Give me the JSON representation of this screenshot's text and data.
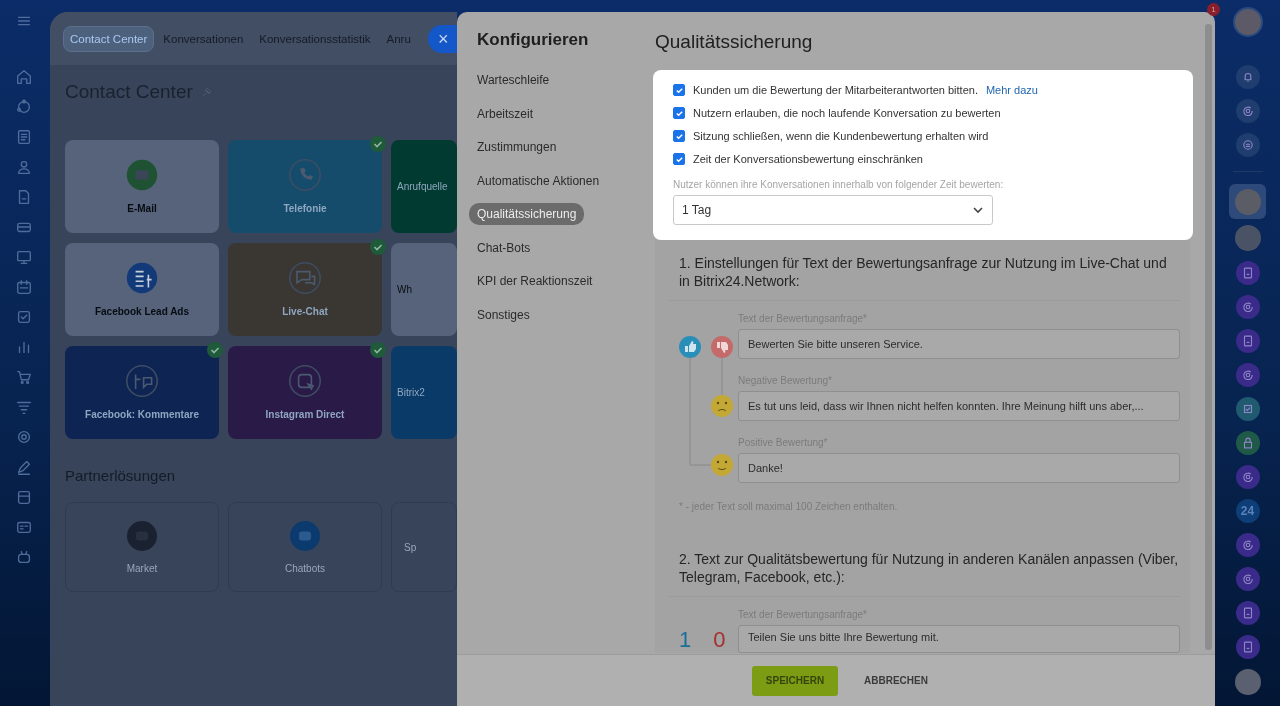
{
  "background_app": {
    "close_label": "×",
    "tabs": [
      {
        "label": "Contact Center",
        "selected": true
      },
      {
        "label": "Konversationen",
        "selected": false
      },
      {
        "label": "Konversationsstatistik",
        "selected": false
      },
      {
        "label": "Anru",
        "selected": false
      }
    ],
    "title": "Contact Center",
    "channels": [
      {
        "label": "E-Mail",
        "color": "#56637a",
        "connected": false
      },
      {
        "label": "Telefonie",
        "color": "#154c6c",
        "connected": true
      },
      {
        "label": "Anrufquelle",
        "color": "#003a30",
        "connected": false
      },
      {
        "label": "Facebook Lead Ads",
        "color": "#56637a",
        "connected": false
      },
      {
        "label": "Live-Chat",
        "color": "#3a3632",
        "connected": true
      },
      {
        "label": "Wh",
        "color": "#56637a",
        "connected": false
      },
      {
        "label": "Facebook: Kommentare",
        "color": "#0e2453",
        "connected": true
      },
      {
        "label": "Instagram Direct",
        "color": "#2a1a48",
        "connected": true
      },
      {
        "label": "Bitrix2",
        "color": "#0a3a68",
        "connected": false
      }
    ],
    "partner_title": "Partnerlösungen",
    "partners": [
      {
        "label": "Market"
      },
      {
        "label": "Chatbots"
      },
      {
        "label": "Sp"
      }
    ]
  },
  "slider": {
    "nav": {
      "title": "Konfigurieren",
      "items": [
        {
          "label": "Warteschleife",
          "selected": false
        },
        {
          "label": "Arbeitszeit",
          "selected": false
        },
        {
          "label": "Zustimmungen",
          "selected": false
        },
        {
          "label": "Automatische Aktionen",
          "selected": false
        },
        {
          "label": "Qualitätssicherung",
          "selected": true
        },
        {
          "label": "Chat-Bots",
          "selected": false
        },
        {
          "label": "KPI der Reaktionszeit",
          "selected": false
        },
        {
          "label": "Sonstiges",
          "selected": false
        }
      ]
    },
    "title": "Qualitätssicherung",
    "options": [
      {
        "label": "Kunden um die Bewertung der Mitarbeiterantworten bitten.",
        "link": "Mehr dazu",
        "checked": true
      },
      {
        "label": "Nutzern erlauben, die noch laufende Konversation zu bewerten",
        "checked": true
      },
      {
        "label": "Sitzung schließen, wenn die Kundenbewertung erhalten wird",
        "checked": true
      },
      {
        "label": "Zeit der Konversationsbewertung einschränken",
        "checked": true
      }
    ],
    "time_limit": {
      "label": "Nutzer können ihre Konversationen innerhalb von folgender Zeit bewerten:",
      "value": "1 Tag"
    },
    "section_1": {
      "heading": "1. Einstellungen für Text der Bewertungsanfrage zur Nutzung im Live-Chat und in Bitrix24.Network:",
      "fields": [
        {
          "label": "Text der Bewertungsanfrage*",
          "value": "Bewerten Sie bitte unseren Service."
        },
        {
          "label": "Negative Bewertung*",
          "value": "Es tut uns leid, dass wir Ihnen nicht helfen konnten. Ihre Meinung hilft uns aber,..."
        },
        {
          "label": "Positive Bewertung*",
          "value": "Danke!"
        }
      ],
      "footnote": "* - jeder Text soll maximal 100 Zeichen enthalten."
    },
    "section_2": {
      "heading": "2. Text zur Qualitätsbewertung für Nutzung in anderen Kanälen anpassen (Viber, Telegram, Facebook, etc.):",
      "positive_digit": "1",
      "negative_digit": "0",
      "field": {
        "label": "Text der Bewertungsanfrage*",
        "value": "Teilen Sie uns bitte Ihre Bewertung mit."
      }
    },
    "buttons": [
      {
        "label": "SPEICHERN",
        "kind": "primary"
      },
      {
        "label": "ABBRECHEN",
        "kind": "link"
      }
    ]
  },
  "right_rail": {
    "badge": "1",
    "app_label": "24"
  }
}
